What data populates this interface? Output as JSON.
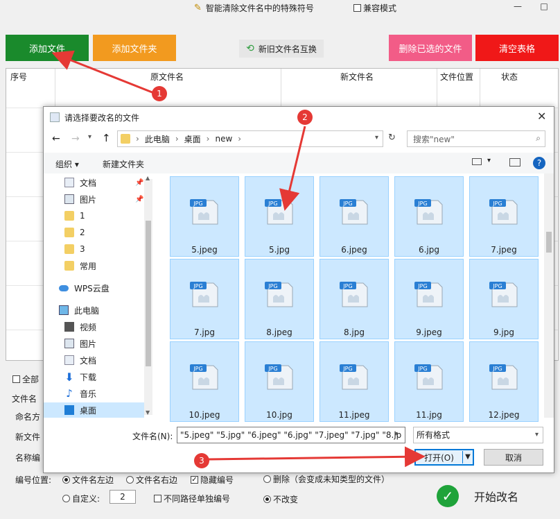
{
  "app": {
    "function_title": "智能清除文件名中的特殊符号",
    "compat_mode_label": "兼容模式",
    "window_controls": [
      "—",
      "□"
    ]
  },
  "toolbar": {
    "add_files": "添加文件",
    "add_folder": "添加文件夹",
    "swap_names": "新旧文件名互换",
    "delete_selected": "删除已选的文件",
    "clear_table": "清空表格",
    "colors": {
      "add_files": "#1a8a2c",
      "add_folder": "#f29a1f",
      "delete_selected": "#f25c87",
      "clear_table": "#f01818"
    }
  },
  "table": {
    "columns": [
      "序号",
      "原文件名",
      "新文件名",
      "文件位置",
      "状态"
    ]
  },
  "bottom": {
    "select_all": "全部",
    "filename_section": "文件名",
    "naming_method": "命名方",
    "new_filename": "新文件",
    "name_number": "名称编",
    "number_position_label": "编号位置:",
    "pos_left": "文件名左边",
    "pos_right": "文件名右边",
    "hide_number": "隐藏编号",
    "custom_label": "自定义:",
    "custom_value": "2",
    "separate_numbering": "不同路径单独编号",
    "delete_option": "删除（会变成未知类型的文件）",
    "no_change": "不改变",
    "start_button": "开始改名"
  },
  "dialog": {
    "title": "请选择要改名的文件",
    "path": [
      "此电脑",
      "桌面",
      "new"
    ],
    "search_placeholder": "搜索\"new\"",
    "organize": "组织 ▾",
    "new_folder": "新建文件夹",
    "nav_items": [
      {
        "label": "文档",
        "icon": "document-icon",
        "pinned": true
      },
      {
        "label": "图片",
        "icon": "picture-icon",
        "pinned": true
      },
      {
        "label": "1",
        "icon": "folder-icon"
      },
      {
        "label": "2",
        "icon": "folder-icon"
      },
      {
        "label": "3",
        "icon": "folder-icon"
      },
      {
        "label": "常用",
        "icon": "folder-icon"
      },
      {
        "label": "WPS云盘",
        "icon": "cloud-icon"
      },
      {
        "label": "此电脑",
        "icon": "computer-icon"
      },
      {
        "label": "视频",
        "icon": "video-icon"
      },
      {
        "label": "图片",
        "icon": "picture-icon"
      },
      {
        "label": "文档",
        "icon": "document-icon"
      },
      {
        "label": "下载",
        "icon": "download-icon"
      },
      {
        "label": "音乐",
        "icon": "music-icon"
      },
      {
        "label": "桌面",
        "icon": "desktop-icon"
      }
    ],
    "files": [
      "5.jpeg",
      "5.jpg",
      "6.jpeg",
      "6.jpg",
      "7.jpeg",
      "7.jpg",
      "8.jpeg",
      "8.jpg",
      "9.jpeg",
      "9.jpg",
      "10.jpeg",
      "10.jpg",
      "11.jpeg",
      "11.jpg",
      "12.jpeg"
    ],
    "file_badge": "JPG",
    "filename_label": "文件名(N):",
    "filename_value": "\"5.jpeg\" \"5.jpg\" \"6.jpeg\" \"6.jpg\" \"7.jpeg\" \"7.jpg\" \"8.jp",
    "filter": "所有格式",
    "open": "打开(O)",
    "cancel": "取消"
  },
  "annotations": [
    "1",
    "2",
    "3"
  ]
}
